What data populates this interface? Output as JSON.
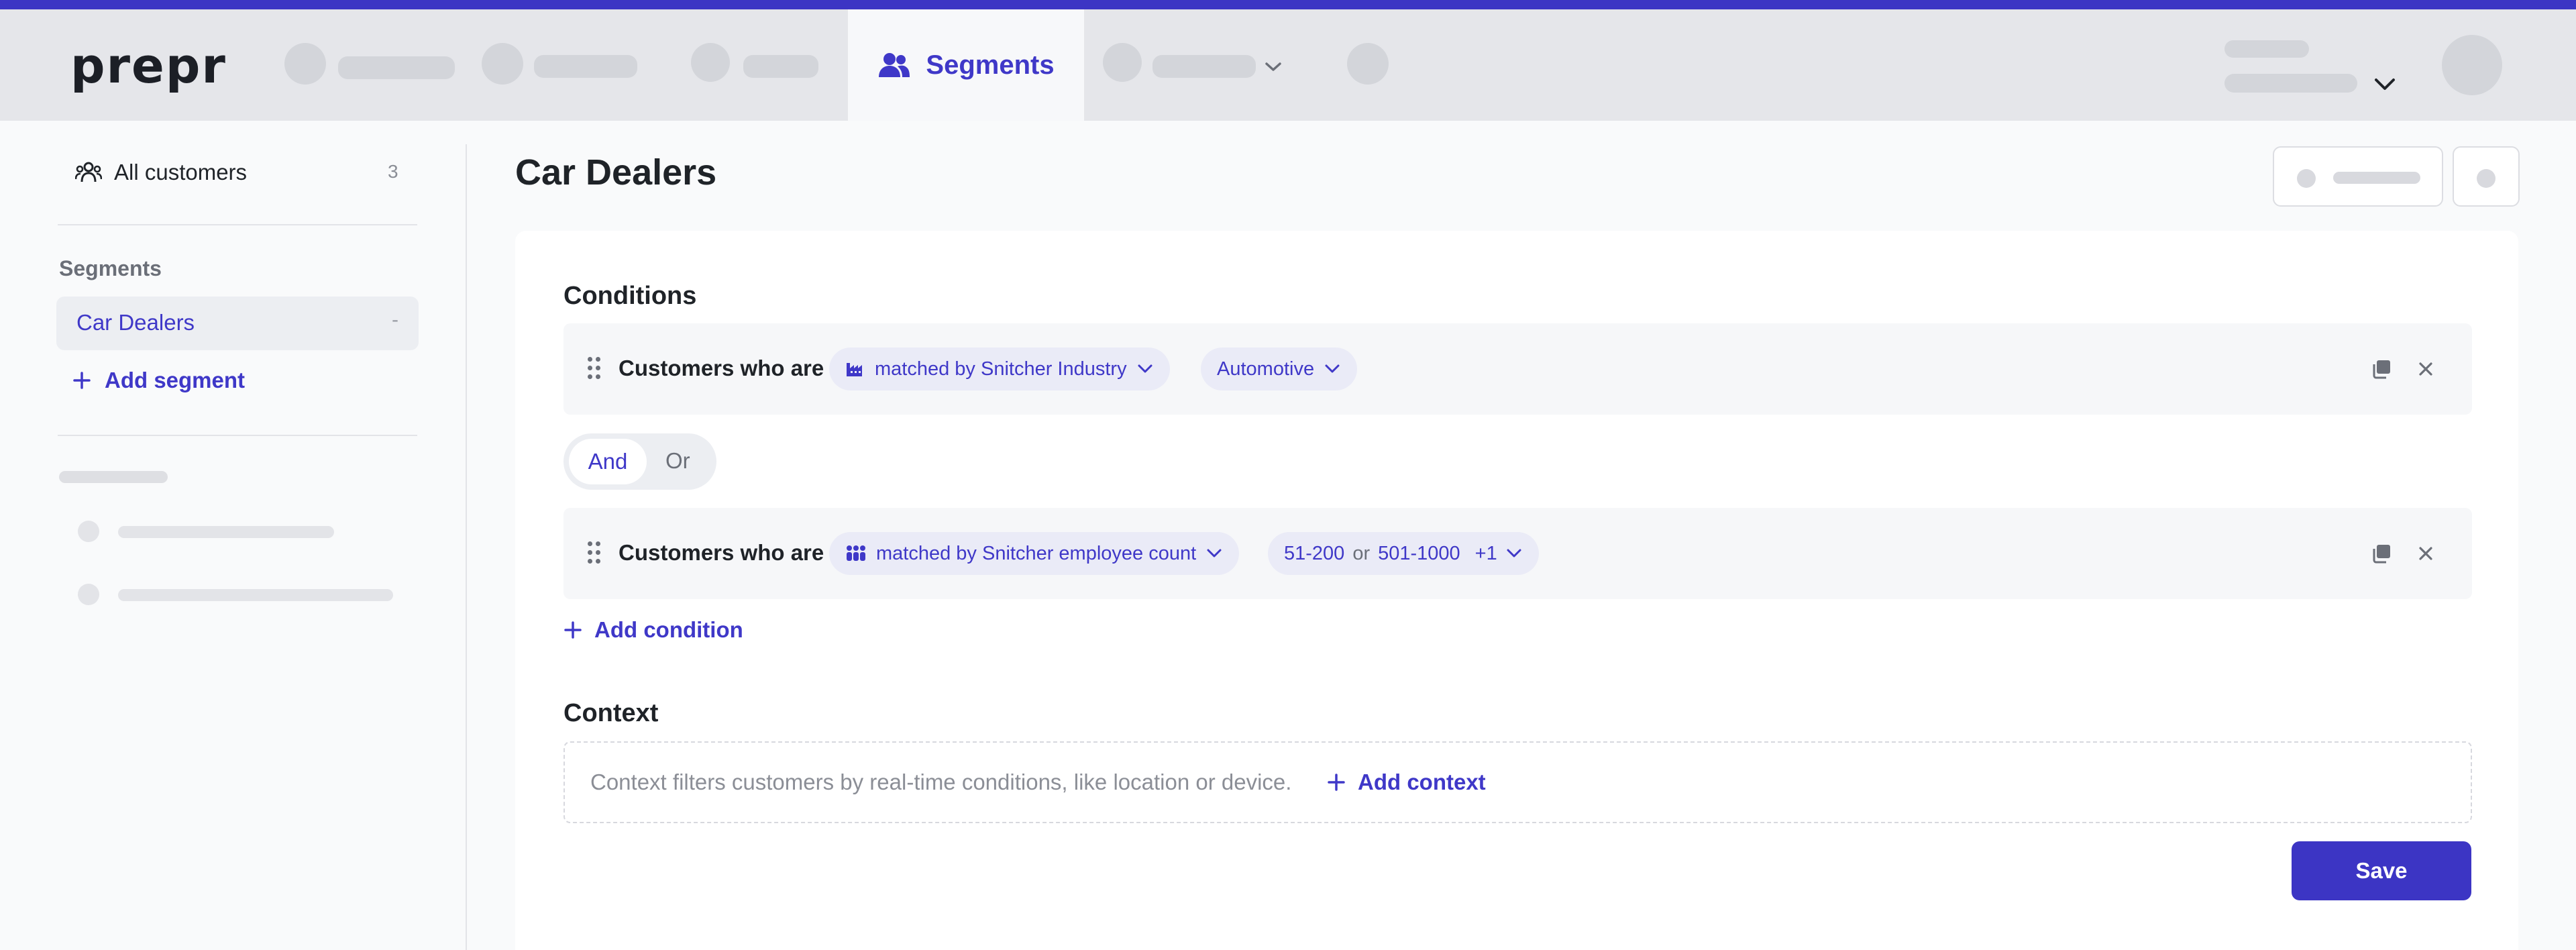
{
  "header": {
    "logo": "prepr",
    "active_nav_label": "Segments"
  },
  "sidebar": {
    "all_customers": {
      "label": "All customers",
      "count": "3"
    },
    "segments_heading": "Segments",
    "segments": [
      {
        "label": "Car Dealers",
        "count": "-"
      }
    ],
    "add_segment_label": "Add segment"
  },
  "main": {
    "title": "Car Dealers",
    "conditions_title": "Conditions",
    "conditions": [
      {
        "label": "Customers who are",
        "matcher": "matched by Snitcher Industry",
        "matcher_icon": "industry-icon",
        "values": [
          "Automotive"
        ]
      },
      {
        "label": "Customers who are",
        "matcher": "matched by Snitcher employee count",
        "matcher_icon": "people-group-icon",
        "values": [
          "51-200",
          "501-1000"
        ],
        "value_joiner": "or",
        "more": "+1"
      }
    ],
    "operator_options": [
      "And",
      "Or"
    ],
    "operator_selected": "And",
    "add_condition_label": "Add condition",
    "context_title": "Context",
    "context_hint": "Context filters customers by real-time conditions, like location or device.",
    "add_context_label": "Add context",
    "save_label": "Save"
  },
  "colors": {
    "accent": "#3c35c4",
    "header_bg": "#e5e6ea",
    "pill_bg": "#eaebf7",
    "link": "#3f38c8"
  }
}
